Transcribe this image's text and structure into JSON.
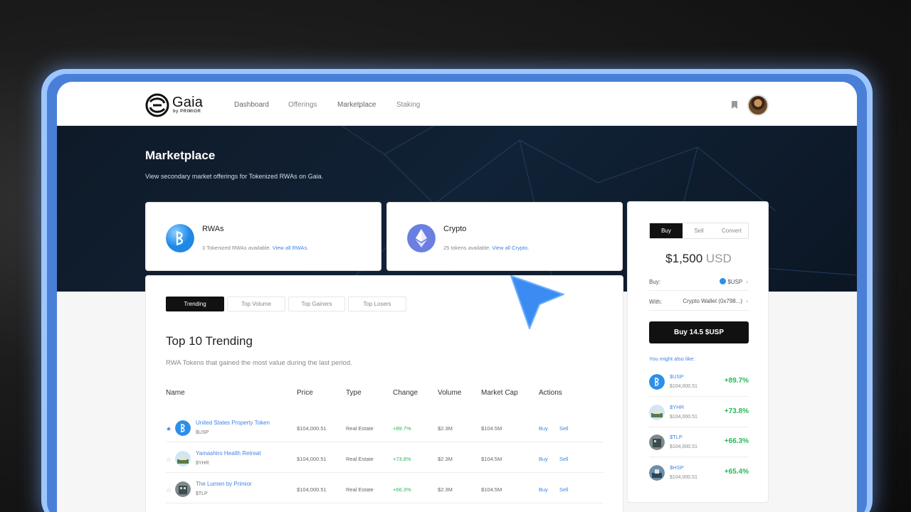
{
  "nav": {
    "brand": "Gaia",
    "brand_sub": "by PRIMIOR",
    "links": [
      "Dashboard",
      "Offerings",
      "Marketplace",
      "Staking"
    ]
  },
  "hero": {
    "title": "Marketplace",
    "subtitle": "View secondary market offerings for Tokenized RWAs on Gaia."
  },
  "categories": [
    {
      "title": "RWAs",
      "desc": "3 Tokenized RWAs available.",
      "link": "View all RWAs."
    },
    {
      "title": "Crypto",
      "desc": "25 tokens available.",
      "link": "View all Crypto."
    }
  ],
  "tabs": [
    "Trending",
    "Top Volume",
    "Top Gainers",
    "Top Losers"
  ],
  "section": {
    "title": "Top 10 Trending",
    "subtitle": "RWA Tokens that gained  the most value during the last period."
  },
  "table": {
    "headers": [
      "Name",
      "Price",
      "Type",
      "Change",
      "Volume",
      "Market Cap",
      "Actions"
    ],
    "rows": [
      {
        "name": "United States Property Token",
        "symbol": "$USP",
        "price": "$104,000.51",
        "type": "Real Estate",
        "change": "+89.7%",
        "volume": "$2.3M",
        "mcap": "$104.5M",
        "buy": "Buy",
        "sell": "Sell",
        "starred": true
      },
      {
        "name": "Yamashiro Health Retreat",
        "symbol": "$YHR",
        "price": "$104,000.51",
        "type": "Real Estate",
        "change": "+73.8%",
        "volume": "$2.3M",
        "mcap": "$104.5M",
        "buy": "Buy",
        "sell": "Sell",
        "starred": false
      },
      {
        "name": "The Lumen by Primior",
        "symbol": "$TLP",
        "price": "$104,000.51",
        "type": "Real Estate",
        "change": "+66.3%",
        "volume": "$2.3M",
        "mcap": "$104.5M",
        "buy": "Buy",
        "sell": "Sell",
        "starred": false
      }
    ]
  },
  "trade": {
    "modes": [
      "Buy",
      "Sell",
      "Convert"
    ],
    "amount": "$1,500",
    "currency": "USD",
    "buy_label": "Buy:",
    "buy_value": "$USP",
    "with_label": "With:",
    "with_value": "Crypto Wallet (0x798...)",
    "button": "Buy 14.5 $USP",
    "also_like": "You might also like:",
    "recommendations": [
      {
        "symbol": "$USP",
        "price": "$104,000.51",
        "change": "+89.7%"
      },
      {
        "symbol": "$YHR",
        "price": "$104,000.51",
        "change": "+73.8%"
      },
      {
        "symbol": "$TLP",
        "price": "$104,000.51",
        "change": "+66.3%"
      },
      {
        "symbol": "$HSP",
        "price": "$104,000.51",
        "change": "+65.4%"
      }
    ]
  },
  "colors": {
    "accent": "#3f84e5",
    "positive": "#2bb65a",
    "hero_bg": "#0f1a28"
  }
}
